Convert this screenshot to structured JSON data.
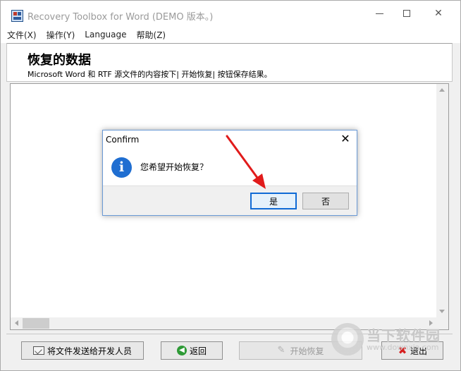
{
  "window": {
    "title": "Recovery Toolbox for Word (DEMO 版本。)",
    "minimize_label": "—",
    "close_glyph": "✕"
  },
  "menu": {
    "items": [
      {
        "label": "文件(X)"
      },
      {
        "label": "操作(Y)"
      },
      {
        "label": "Language"
      },
      {
        "label": "帮助(Z)"
      }
    ]
  },
  "header": {
    "title": "恢复的数据",
    "subtitle": "Microsoft Word 和 RTF 源文件的内容按下| 开始恢复| 按钮保存结果。"
  },
  "buttons": {
    "send": "将文件发送给开发人员",
    "back": "返回",
    "start": "开始恢复",
    "exit": "退出",
    "send_icon": "send-file-icon",
    "back_icon": "back-arrow-icon",
    "start_icon": "start-recovery-icon",
    "exit_icon": "exit-x-icon"
  },
  "dialog": {
    "title": "Confirm",
    "message": "您希望开始恢复？",
    "icon": "info-icon",
    "close_glyph": "✕",
    "yes": "是",
    "no": "否"
  },
  "colors": {
    "accent": "#1f6ed1",
    "annotation_arrow": "#e11b1b",
    "exit_icon": "#d61f1f",
    "back_icon": "#2e9a36"
  },
  "watermark": {
    "line1": "当下软件园",
    "line2": "www.downxia.com"
  }
}
